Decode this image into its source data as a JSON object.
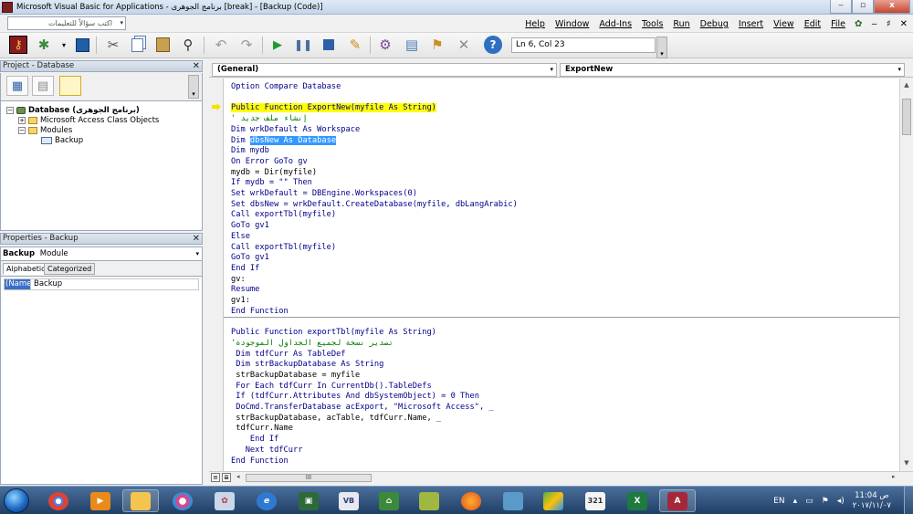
{
  "window": {
    "title": "Microsoft Visual Basic for Applications - برنامج الجوهرى [break] - [Backup (Code)]",
    "min_label": "‒",
    "max_label": "▫",
    "close_label": "x"
  },
  "menubar": {
    "ask_placeholder": "اكتب سؤالاً للتعليمات",
    "dropdown_glyph": "▾",
    "items": [
      "Help",
      "Window",
      "Add-Ins",
      "Tools",
      "Run",
      "Debug",
      "Insert",
      "View",
      "Edit",
      "File"
    ],
    "mdi_glyphs": [
      "‒",
      "♯",
      "✕"
    ]
  },
  "toolbar": {
    "position": "Ln 6, Col 23",
    "icons": [
      "access-icon",
      "insert-module-icon",
      "save-icon",
      "cut-icon",
      "copy-icon",
      "paste-icon",
      "find-icon",
      "undo-icon",
      "redo-icon",
      "run-icon",
      "break-icon",
      "reset-icon",
      "design-mode-icon",
      "project-explorer-icon",
      "properties-icon",
      "object-browser-icon",
      "toolbox-icon",
      "help-icon"
    ]
  },
  "project_pane": {
    "title": "Project - Database",
    "close": "✕",
    "tree": [
      {
        "label": "Database",
        "suffix": "(برنامج الجوهرى)",
        "expander": "−",
        "indent": 0
      },
      {
        "label": "Microsoft Access Class Objects",
        "expander": "+",
        "indent": 1
      },
      {
        "label": "Modules",
        "expander": "−",
        "indent": 1
      },
      {
        "label": "Backup",
        "expander": "",
        "indent": 2
      }
    ]
  },
  "properties_pane": {
    "title": "Properties - Backup",
    "close": "✕",
    "object_name": "Backup",
    "object_type": "Module",
    "tabs": [
      "Alphabetic",
      "Categorized"
    ],
    "selected_tab": "Alphabetic",
    "rows": [
      {
        "name": "(Name)",
        "value": "Backup"
      }
    ]
  },
  "code_window": {
    "object_combo": "(General)",
    "proc_combo": "ExportNew",
    "scroll_thumb": "III",
    "lines": [
      {
        "text": "Option Compare Database",
        "kind": "kw"
      },
      {
        "text": "",
        "kind": ""
      },
      {
        "text": "Public Function ExportNew(myfile As String)",
        "kind": "hl"
      },
      {
        "text": "' إنشاء ملف جديد",
        "kind": "cm"
      },
      {
        "text": "Dim wrkDefault As Workspace",
        "kind": "kw"
      },
      {
        "text": "Dim dbsNew As Database",
        "kind": "sel"
      },
      {
        "text": "Dim mydb",
        "kind": "kw"
      },
      {
        "text": "On Error GoTo gv",
        "kind": "kw"
      },
      {
        "text": "mydb = Dir(myfile)",
        "kind": ""
      },
      {
        "text": "If mydb = \"\" Then",
        "kind": "kw"
      },
      {
        "text": "Set wrkDefault = DBEngine.Workspaces(0)",
        "kind": "kw"
      },
      {
        "text": "Set dbsNew = wrkDefault.CreateDatabase(myfile, dbLangArabic)",
        "kind": "kw"
      },
      {
        "text": "Call exportTbl(myfile)",
        "kind": "kw"
      },
      {
        "text": "GoTo gv1",
        "kind": "kw"
      },
      {
        "text": "Else",
        "kind": "kw"
      },
      {
        "text": "Call exportTbl(myfile)",
        "kind": "kw"
      },
      {
        "text": "GoTo gv1",
        "kind": "kw"
      },
      {
        "text": "End If",
        "kind": "kw"
      },
      {
        "text": "gv:",
        "kind": ""
      },
      {
        "text": "Resume",
        "kind": "kw"
      },
      {
        "text": "gv1:",
        "kind": ""
      },
      {
        "text": "End Function",
        "kind": "kw"
      },
      {
        "text": "",
        "kind": ""
      },
      {
        "text": "Public Function exportTbl(myfile As String)",
        "kind": "kw"
      },
      {
        "text": "'تصدير نسخة لجميع الجداول الموجودة",
        "kind": "cm"
      },
      {
        "text": " Dim tdfCurr As TableDef",
        "kind": "kw"
      },
      {
        "text": " Dim strBackupDatabase As String",
        "kind": "kw"
      },
      {
        "text": " strBackupDatabase = myfile",
        "kind": ""
      },
      {
        "text": " For Each tdfCurr In CurrentDb().TableDefs",
        "kind": "kw"
      },
      {
        "text": " If (tdfCurr.Attributes And dbSystemObject) = 0 Then",
        "kind": "kw"
      },
      {
        "text": " DoCmd.TransferDatabase acExport, \"Microsoft Access\", _",
        "kind": "kw"
      },
      {
        "text": " strBackupDatabase, acTable, tdfCurr.Name, _",
        "kind": ""
      },
      {
        "text": " tdfCurr.Name",
        "kind": ""
      },
      {
        "text": "    End If",
        "kind": "kw"
      },
      {
        "text": "   Next tdfCurr",
        "kind": "kw"
      },
      {
        "text": "End Function",
        "kind": "kw"
      }
    ]
  },
  "taskbar": {
    "apps": [
      "start-orb",
      "chrome-icon",
      "media-player-icon",
      "explorer-icon",
      "browser-swirl-icon",
      "paint-icon",
      "ie-icon",
      "quran-app-icon",
      "vb-icon",
      "building-app-icon",
      "ebook-icon",
      "firefox-icon",
      "notes-icon",
      "bluestacks-icon",
      "calendar-icon",
      "excel-icon",
      "access-icon"
    ],
    "lang": "EN",
    "time": "11:04 ص",
    "date": "٢٠١٧/١١/٠٧",
    "calendar_label": "321"
  }
}
